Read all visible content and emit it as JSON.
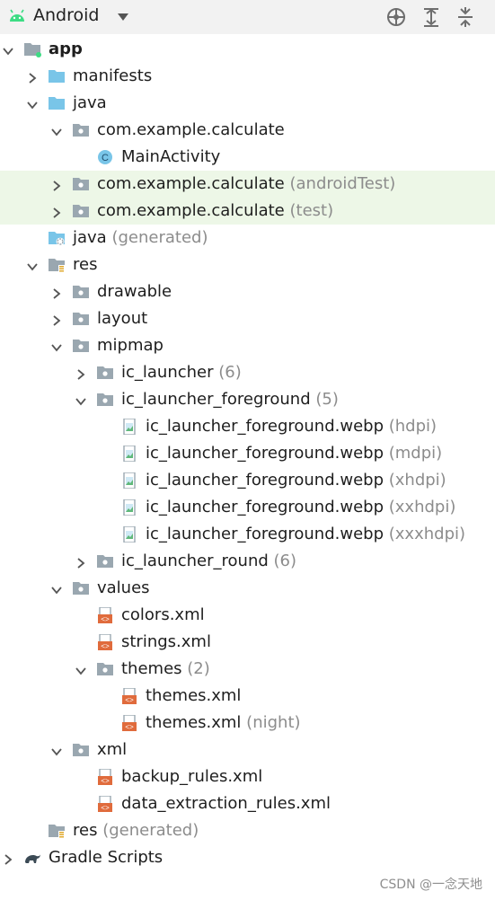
{
  "toolbar": {
    "title": "Android"
  },
  "tree": [
    {
      "label": "app",
      "dim": "",
      "icon": "module-folder-icon",
      "arrow": "down",
      "bold": true
    },
    {
      "label": "manifests",
      "dim": "",
      "icon": "folder-icon",
      "arrow": "right"
    },
    {
      "label": "java",
      "dim": "",
      "icon": "folder-icon",
      "arrow": "down"
    },
    {
      "label": "com.example.calculate",
      "dim": "",
      "icon": "package-icon",
      "arrow": "down"
    },
    {
      "label": "MainActivity",
      "dim": "",
      "icon": "class-icon",
      "arrow": ""
    },
    {
      "label": "com.example.calculate",
      "dim": "(androidTest)",
      "icon": "package-icon",
      "arrow": "right",
      "sel": true
    },
    {
      "label": "com.example.calculate",
      "dim": "(test)",
      "icon": "package-icon",
      "arrow": "right",
      "sel": true
    },
    {
      "label": "java",
      "dim": "(generated)",
      "icon": "generated-folder-icon",
      "arrow": ""
    },
    {
      "label": "res",
      "dim": "",
      "icon": "res-folder-icon",
      "arrow": "down"
    },
    {
      "label": "drawable",
      "dim": "",
      "icon": "package-icon",
      "arrow": "right"
    },
    {
      "label": "layout",
      "dim": "",
      "icon": "package-icon",
      "arrow": "right"
    },
    {
      "label": "mipmap",
      "dim": "",
      "icon": "package-icon",
      "arrow": "down"
    },
    {
      "label": "ic_launcher",
      "dim": "(6)",
      "icon": "package-icon",
      "arrow": "right"
    },
    {
      "label": "ic_launcher_foreground",
      "dim": "(5)",
      "icon": "package-icon",
      "arrow": "down"
    },
    {
      "label": "ic_launcher_foreground.webp",
      "dim": "(hdpi)",
      "icon": "image-file-icon",
      "arrow": ""
    },
    {
      "label": "ic_launcher_foreground.webp",
      "dim": "(mdpi)",
      "icon": "image-file-icon",
      "arrow": ""
    },
    {
      "label": "ic_launcher_foreground.webp",
      "dim": "(xhdpi)",
      "icon": "image-file-icon",
      "arrow": ""
    },
    {
      "label": "ic_launcher_foreground.webp",
      "dim": "(xxhdpi)",
      "icon": "image-file-icon",
      "arrow": ""
    },
    {
      "label": "ic_launcher_foreground.webp",
      "dim": "(xxxhdpi)",
      "icon": "image-file-icon",
      "arrow": ""
    },
    {
      "label": "ic_launcher_round",
      "dim": "(6)",
      "icon": "package-icon",
      "arrow": "right"
    },
    {
      "label": "values",
      "dim": "",
      "icon": "package-icon",
      "arrow": "down"
    },
    {
      "label": "colors.xml",
      "dim": "",
      "icon": "xml-file-icon",
      "arrow": ""
    },
    {
      "label": "strings.xml",
      "dim": "",
      "icon": "xml-file-icon",
      "arrow": ""
    },
    {
      "label": "themes",
      "dim": "(2)",
      "icon": "package-icon",
      "arrow": "down"
    },
    {
      "label": "themes.xml",
      "dim": "",
      "icon": "xml-file-icon",
      "arrow": ""
    },
    {
      "label": "themes.xml",
      "dim": "(night)",
      "icon": "xml-file-icon",
      "arrow": ""
    },
    {
      "label": "xml",
      "dim": "",
      "icon": "package-icon",
      "arrow": "down"
    },
    {
      "label": "backup_rules.xml",
      "dim": "",
      "icon": "xml-file-icon",
      "arrow": ""
    },
    {
      "label": "data_extraction_rules.xml",
      "dim": "",
      "icon": "xml-file-icon",
      "arrow": ""
    },
    {
      "label": "res",
      "dim": "(generated)",
      "icon": "res-folder-icon",
      "arrow": ""
    },
    {
      "label": "Gradle Scripts",
      "dim": "",
      "icon": "gradle-icon",
      "arrow": "right"
    }
  ],
  "watermark": "CSDN @一念天地",
  "colors": {
    "accent_green": "#3ddc84",
    "folder_blue": "#79c5e8",
    "package_gray": "#9aa7b0",
    "selection_bg": "#edf7e7",
    "xml_orange": "#e06b3c"
  }
}
